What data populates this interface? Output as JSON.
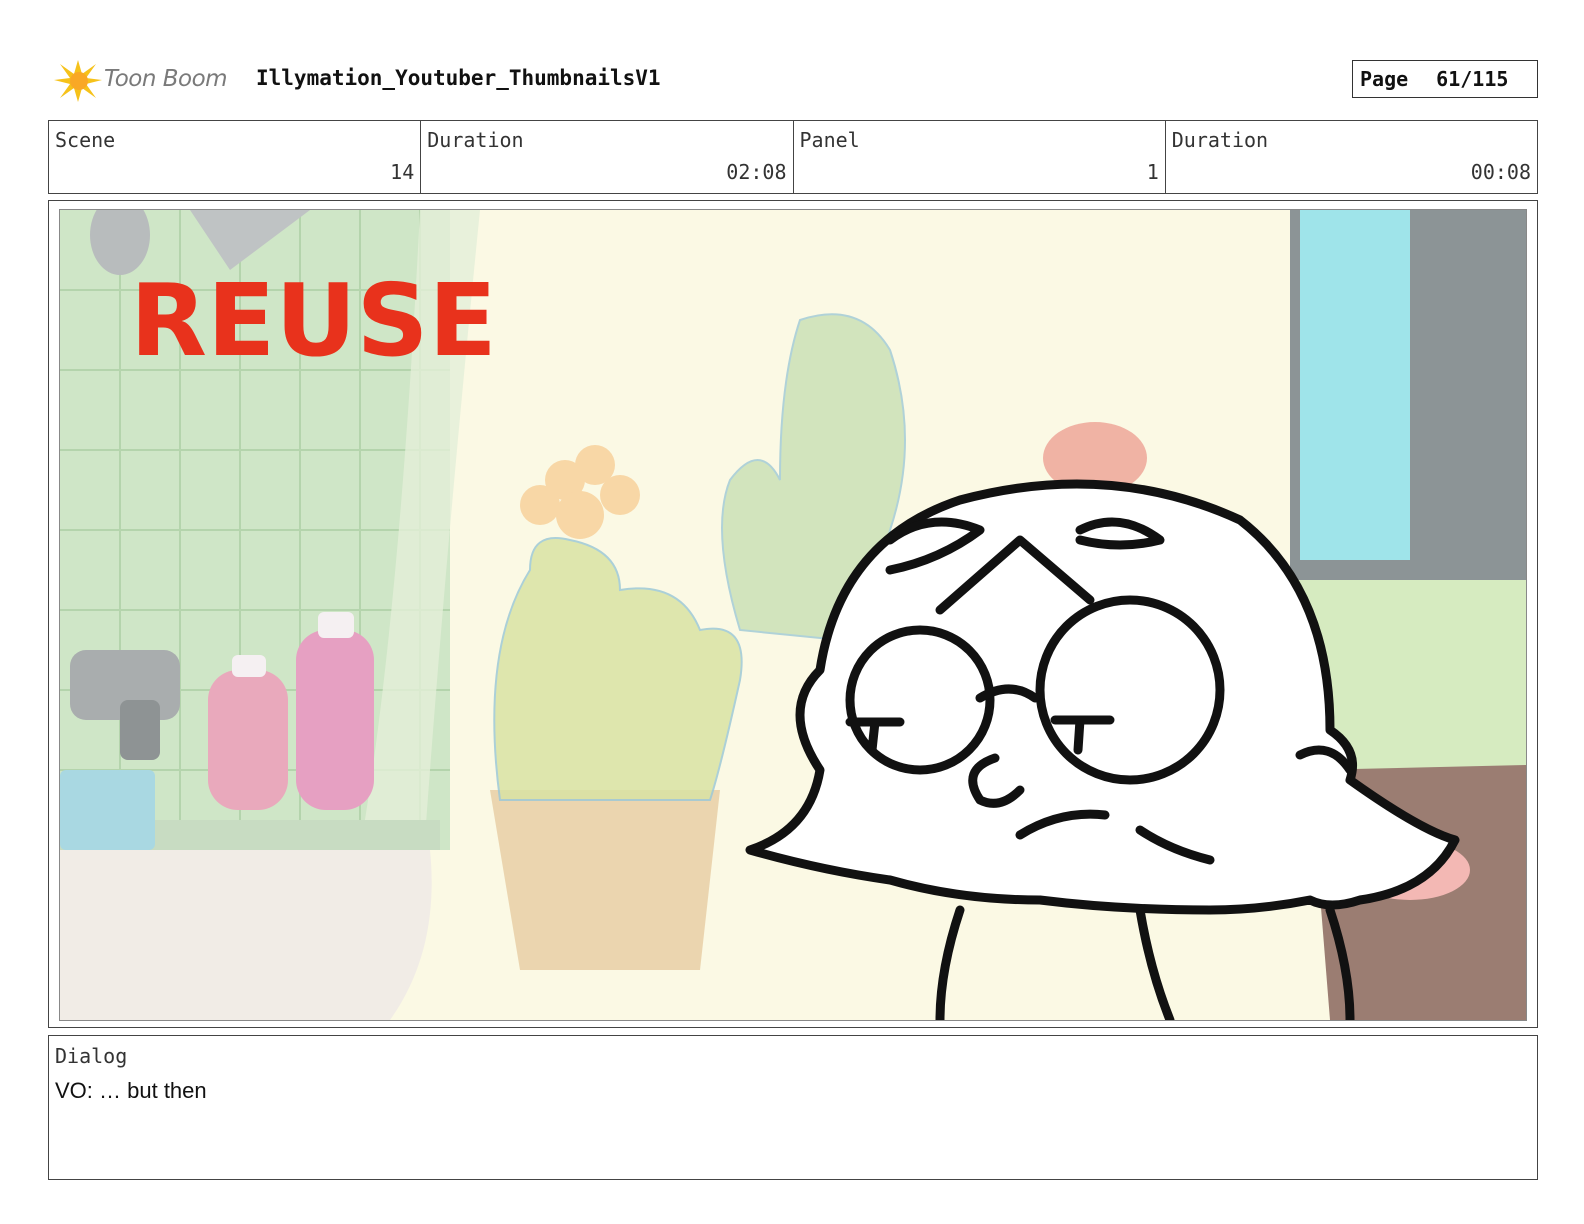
{
  "header": {
    "logo_text": "Toon Boom",
    "doc_title": "Illymation_Youtuber_ThumbnailsV1",
    "page_label": "Page",
    "page_value": "61/115"
  },
  "info": {
    "scene_label": "Scene",
    "scene_value": "14",
    "scene_duration_label": "Duration",
    "scene_duration_value": "02:08",
    "panel_label": "Panel",
    "panel_value": "1",
    "panel_duration_label": "Duration",
    "panel_duration_value": "00:08"
  },
  "panel": {
    "reuse_text": "REUSE",
    "reuse_color": "#e8321c"
  },
  "dialog": {
    "label": "Dialog",
    "text": "VO: … but then"
  }
}
